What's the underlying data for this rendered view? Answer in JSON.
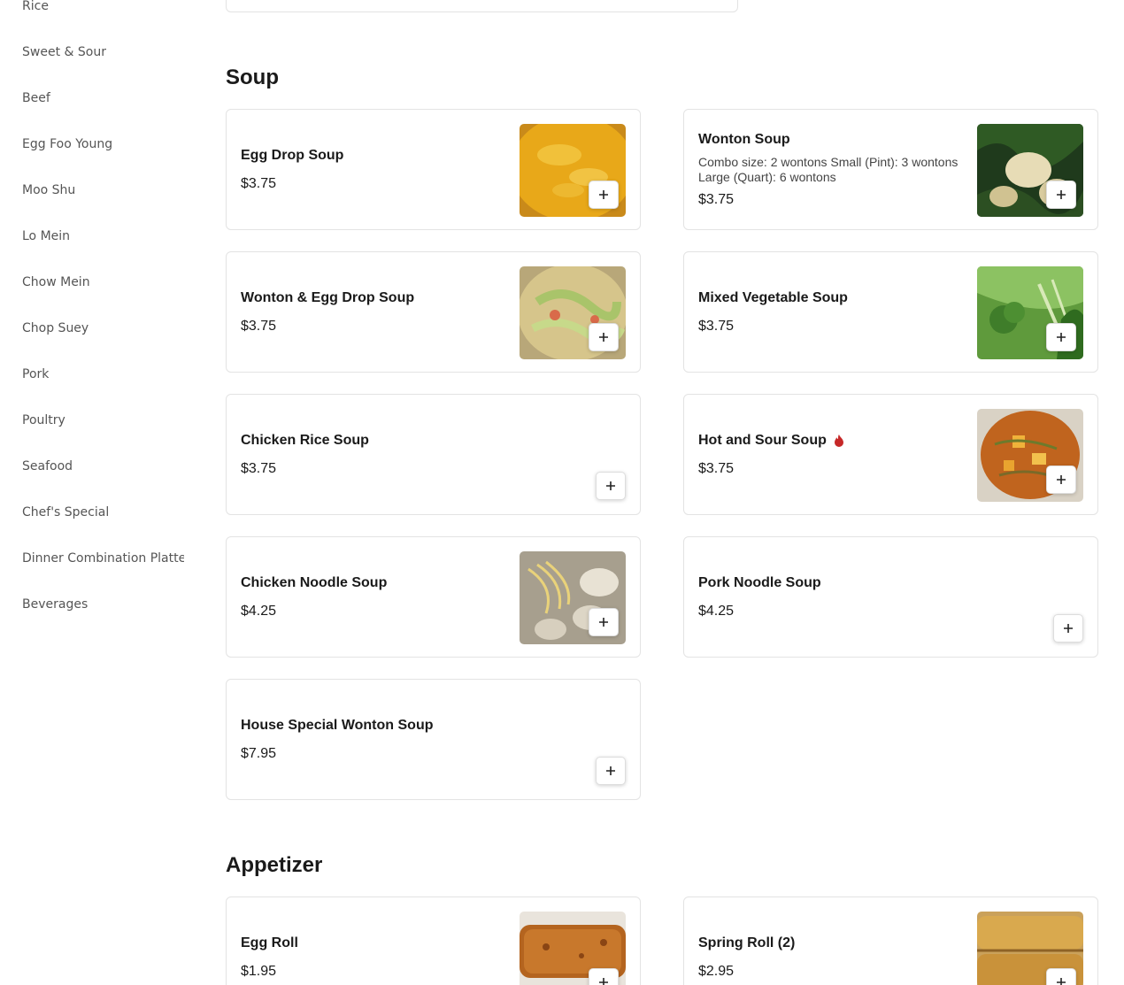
{
  "sidebar": {
    "items": [
      {
        "label": "Rice"
      },
      {
        "label": "Sweet & Sour"
      },
      {
        "label": "Beef"
      },
      {
        "label": "Egg Foo Young"
      },
      {
        "label": "Moo Shu"
      },
      {
        "label": "Lo Mein"
      },
      {
        "label": "Chow Mein"
      },
      {
        "label": "Chop Suey"
      },
      {
        "label": "Pork"
      },
      {
        "label": "Poultry"
      },
      {
        "label": "Seafood"
      },
      {
        "label": "Chef's Special"
      },
      {
        "label": "Dinner Combination Platter"
      },
      {
        "label": "Beverages"
      }
    ]
  },
  "soup": {
    "title": "Soup",
    "items": [
      {
        "name": "Egg Drop Soup",
        "price": "$3.75",
        "image": "egg-drop-soup-photo"
      },
      {
        "name": "Wonton Soup",
        "desc": "Combo size: 2 wontons Small (Pint): 3 wontons Large (Quart): 6 wontons",
        "price": "$3.75",
        "image": "wonton-soup-photo"
      },
      {
        "name": "Wonton & Egg Drop Soup",
        "price": "$3.75",
        "image": "wonton-egg-drop-soup-photo"
      },
      {
        "name": "Mixed Vegetable Soup",
        "price": "$3.75",
        "image": "mixed-vegetable-soup-photo"
      },
      {
        "name": "Chicken Rice Soup",
        "price": "$3.75"
      },
      {
        "name": "Hot and Sour Soup",
        "price": "$3.75",
        "image": "hot-sour-soup-photo",
        "icon": "spicy-fire-icon"
      },
      {
        "name": "Chicken Noodle Soup",
        "price": "$4.25",
        "image": "chicken-noodle-soup-photo"
      },
      {
        "name": "Pork Noodle Soup",
        "price": "$4.25"
      },
      {
        "name": "House Special Wonton Soup",
        "price": "$7.95"
      }
    ]
  },
  "appetizer": {
    "title": "Appetizer",
    "items": [
      {
        "name": "Egg Roll",
        "price": "$1.95",
        "image": "egg-roll-photo"
      },
      {
        "name": "Spring Roll (2)",
        "price": "$2.95",
        "image": "spring-roll-photo"
      }
    ]
  },
  "icons": {
    "add": "plus-icon",
    "spicy": "fire-icon"
  },
  "colors": {
    "spicy": "#c62828",
    "border": "#e3e3e3"
  }
}
